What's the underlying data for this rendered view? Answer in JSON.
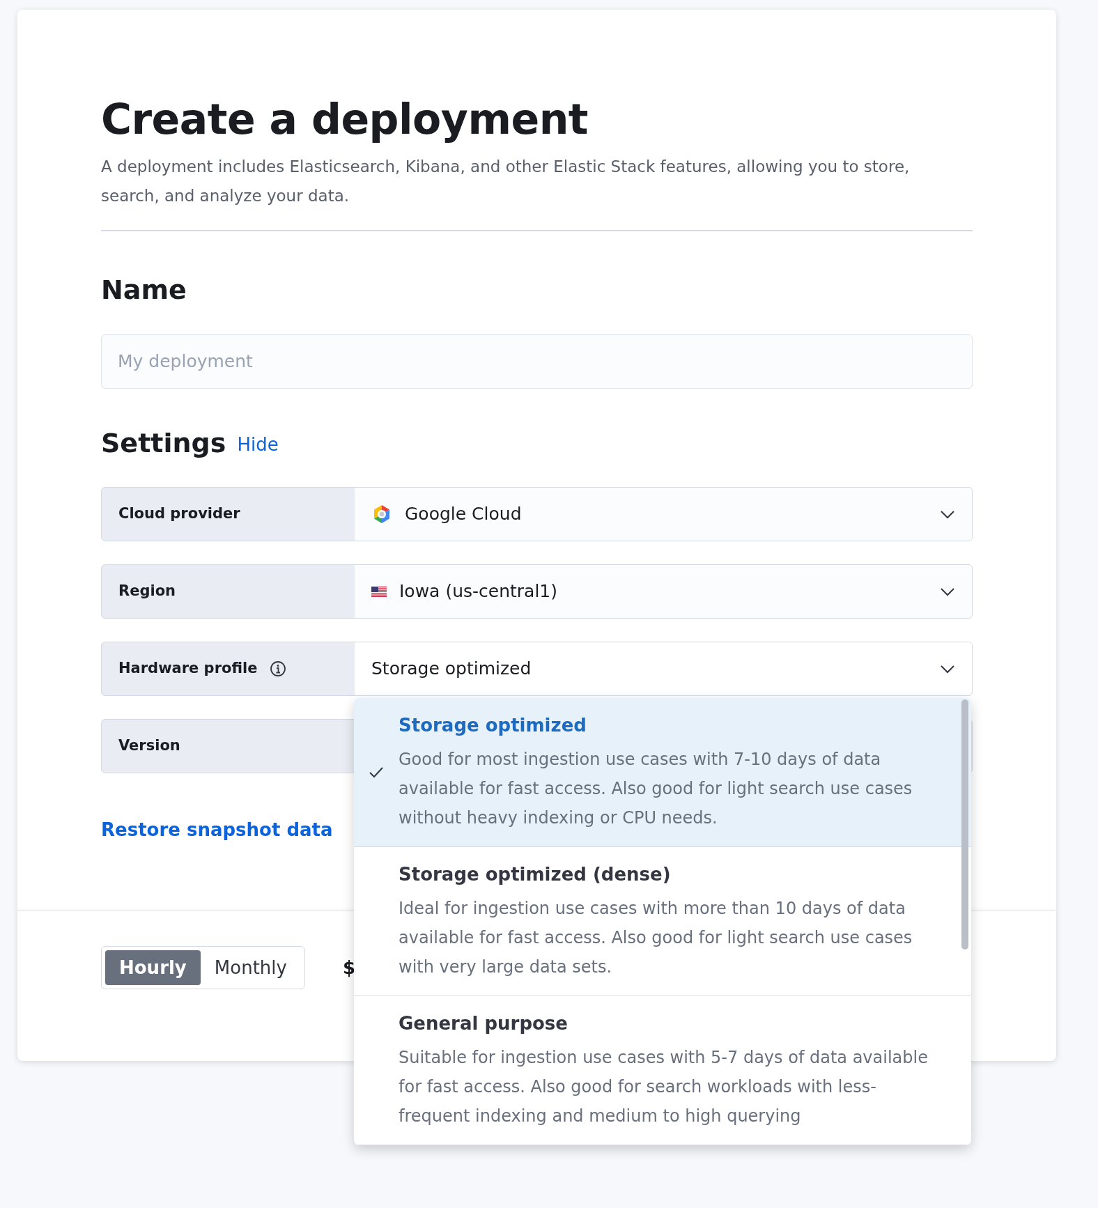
{
  "page": {
    "title": "Create a deployment",
    "description": "A deployment includes Elasticsearch, Kibana, and other Elastic Stack features, allowing you to store, search, and analyze your data."
  },
  "name_section": {
    "heading": "Name",
    "input": {
      "placeholder": "My deployment"
    }
  },
  "settings": {
    "heading": "Settings",
    "toggle_link": "Hide",
    "fields": [
      {
        "label": "Cloud provider",
        "value": "Google Cloud",
        "kind": "provider"
      },
      {
        "label": "Region",
        "value": "Iowa (us-central1)",
        "kind": "region"
      },
      {
        "label": "Hardware profile",
        "value": "Storage optimized",
        "kind": "profile",
        "options": [
          {
            "title": "Storage optimized",
            "description": "Good for most ingestion use cases with 7-10 days of data available for fast access. Also good for light search use cases without heavy indexing or CPU needs.",
            "selected": true
          },
          {
            "title": "Storage optimized (dense)",
            "description": "Ideal for ingestion use cases with more than 10 days of data available for fast access. Also good for light search use cases with very large data sets.",
            "selected": false
          },
          {
            "title": "General purpose",
            "description": "Suitable for ingestion use cases with 5-7 days of data available for fast access. Also good for search workloads with less-frequent indexing and medium to high querying",
            "selected": false
          }
        ]
      },
      {
        "label": "Version",
        "kind": "plain"
      }
    ]
  },
  "restore_link": "Restore snapshot data",
  "footer": {
    "billing_toggle": [
      {
        "label": "Hourly",
        "selected": true
      },
      {
        "label": "Monthly",
        "selected": false
      }
    ],
    "price_fragment": "$"
  }
}
